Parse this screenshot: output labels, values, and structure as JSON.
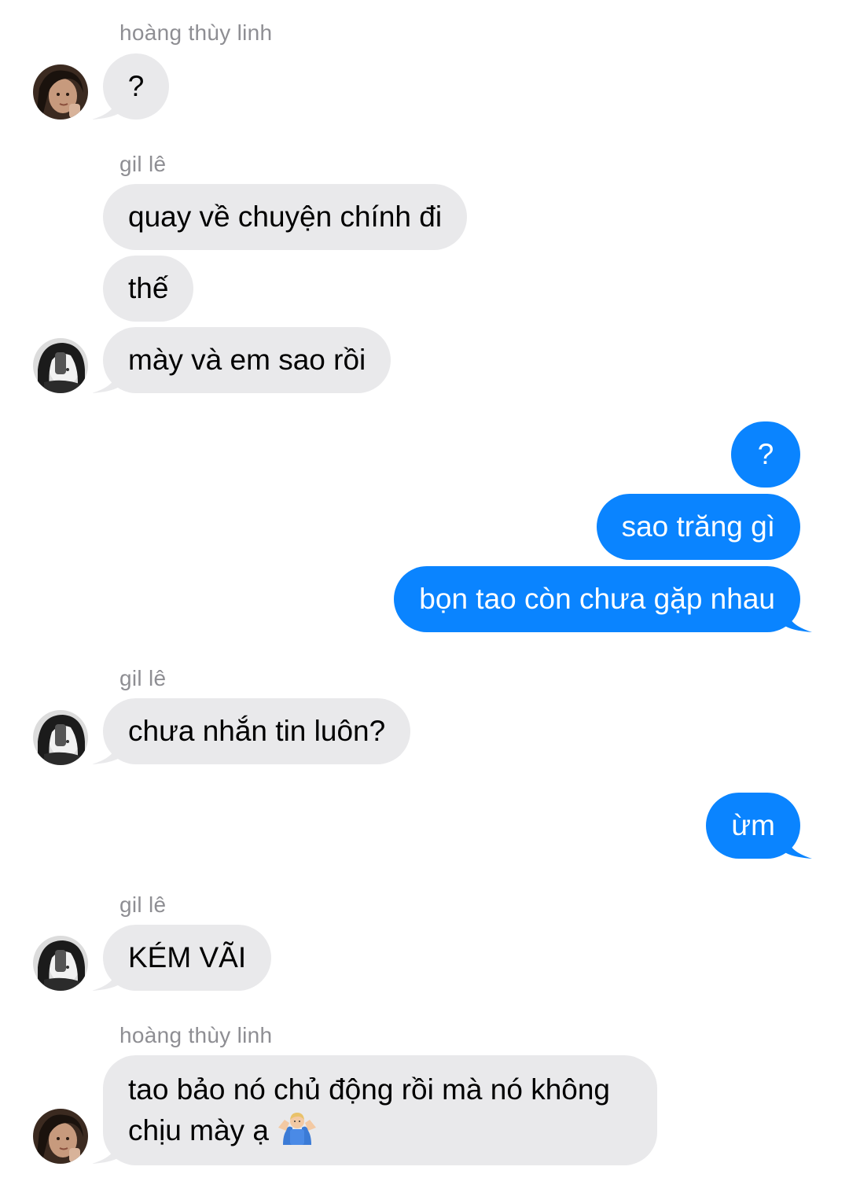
{
  "chat": {
    "colors": {
      "incoming_bubble": "#e9e9eb",
      "outgoing_bubble": "#0a84ff",
      "sender_name": "#8e8e93"
    },
    "senders": {
      "s1": "hoàng thùy linh",
      "s2": "gil lê",
      "s3": "gil lê",
      "s4": "gil lê",
      "s5": "hoàng thùy linh"
    },
    "messages": {
      "m1": "?",
      "m2": "quay về chuyện chính đi",
      "m3": "thế",
      "m4": "mày và em sao rồi",
      "m5": "?",
      "m6": "sao trăng gì",
      "m7": "bọn tao còn chưa gặp nhau",
      "m8": "chưa nhắn tin luôn?",
      "m9": "ừm",
      "m10": "KÉM VÃI",
      "m11_line1": "tao bảo nó chủ động rồi mà nó không",
      "m11_line2": "chịu mày ạ",
      "m11_emoji": "person-shrugging-emoji"
    }
  }
}
